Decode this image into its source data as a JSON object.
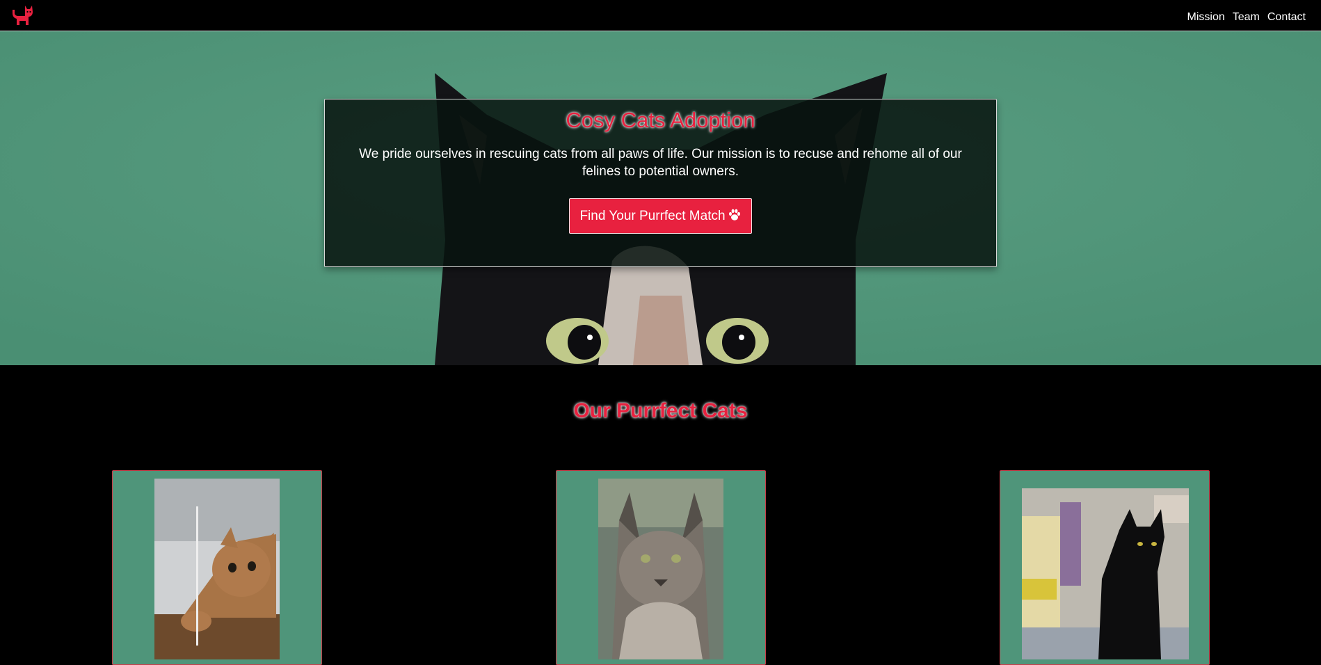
{
  "nav": {
    "logo_icon": "cat-icon",
    "links": [
      "Mission",
      "Team",
      "Contact"
    ]
  },
  "hero": {
    "title": "Cosy Cats Adoption",
    "text": "We pride ourselves in rescuing cats from all paws of life. Our mission is to recuse and rehome all of our felines to potential owners.",
    "button_label": "Find Your Purrfect Match",
    "button_icon": "paw-icon"
  },
  "cats_section": {
    "title": "Our Purrfect Cats"
  },
  "colors": {
    "accent": "#e8213f",
    "green": "#4f957a",
    "background": "#000000"
  }
}
